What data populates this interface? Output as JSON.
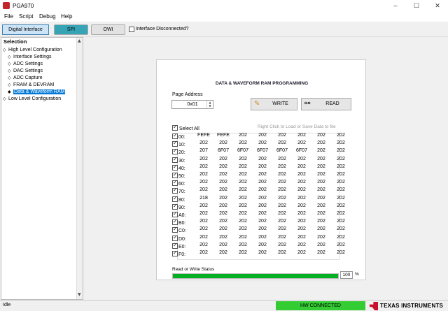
{
  "window": {
    "title": "PGA970",
    "controls": [
      "–",
      "☐",
      "✕"
    ]
  },
  "menu": [
    "File",
    "Script",
    "Debug",
    "Help"
  ],
  "toolbar": {
    "digital_interface": "Digital Interface",
    "spi": "SPI",
    "owi": "OWI",
    "disconnected_label": "Interface Disconnected?"
  },
  "selection": {
    "header": "Selection",
    "items": [
      {
        "label": "High Level Configuration",
        "level": 0,
        "bullet": "◇"
      },
      {
        "label": "Interface Settings",
        "level": 1,
        "bullet": "◇"
      },
      {
        "label": "ADC Settings",
        "level": 1,
        "bullet": "◇"
      },
      {
        "label": "DAC Settings",
        "level": 1,
        "bullet": "◇"
      },
      {
        "label": "ADC Capture",
        "level": 1,
        "bullet": "◇"
      },
      {
        "label": "FRAM & DEVRAM",
        "level": 1,
        "bullet": "◇"
      },
      {
        "label": "Data & Waveform RAM",
        "level": 1,
        "bullet": "◆",
        "selected": true
      },
      {
        "label": "Low Level Configuration",
        "level": 0,
        "bullet": "◇"
      }
    ]
  },
  "ram": {
    "title": "DATA & WAVEFORM RAM PROGRAMMING",
    "page_address_label": "Page Address",
    "page_address_value": "0x01",
    "write_label": "WRITE",
    "read_label": "READ",
    "hint": "Right Click to Load or Save Data to file",
    "select_all": "Select All",
    "rows": [
      {
        "addr": "00:",
        "cells": [
          "FEFE",
          "FEFE",
          "202",
          "202",
          "202",
          "202",
          "202",
          "202"
        ]
      },
      {
        "addr": "10:",
        "cells": [
          "202",
          "202",
          "202",
          "202",
          "202",
          "202",
          "202",
          "202"
        ]
      },
      {
        "addr": "20:",
        "cells": [
          "207",
          "6F07",
          "6F07",
          "6F07",
          "6F07",
          "6F07",
          "202",
          "202"
        ]
      },
      {
        "addr": "30:",
        "cells": [
          "202",
          "202",
          "202",
          "202",
          "202",
          "202",
          "202",
          "202"
        ]
      },
      {
        "addr": "40:",
        "cells": [
          "202",
          "202",
          "202",
          "202",
          "202",
          "202",
          "202",
          "202"
        ]
      },
      {
        "addr": "50:",
        "cells": [
          "202",
          "202",
          "202",
          "202",
          "202",
          "202",
          "202",
          "202"
        ]
      },
      {
        "addr": "60:",
        "cells": [
          "202",
          "202",
          "202",
          "202",
          "202",
          "202",
          "202",
          "202"
        ]
      },
      {
        "addr": "70:",
        "cells": [
          "202",
          "202",
          "202",
          "202",
          "202",
          "202",
          "202",
          "202"
        ]
      },
      {
        "addr": "80:",
        "cells": [
          "218",
          "202",
          "202",
          "202",
          "202",
          "202",
          "202",
          "202"
        ]
      },
      {
        "addr": "90:",
        "cells": [
          "202",
          "202",
          "202",
          "202",
          "202",
          "202",
          "202",
          "202"
        ]
      },
      {
        "addr": "A0:",
        "cells": [
          "202",
          "202",
          "202",
          "202",
          "202",
          "202",
          "202",
          "202"
        ]
      },
      {
        "addr": "B0:",
        "cells": [
          "202",
          "202",
          "202",
          "202",
          "202",
          "202",
          "202",
          "202"
        ]
      },
      {
        "addr": "C0:",
        "cells": [
          "202",
          "202",
          "202",
          "202",
          "202",
          "202",
          "202",
          "202"
        ]
      },
      {
        "addr": "D0:",
        "cells": [
          "202",
          "202",
          "202",
          "202",
          "202",
          "202",
          "202",
          "202"
        ]
      },
      {
        "addr": "E0:",
        "cells": [
          "202",
          "202",
          "202",
          "202",
          "202",
          "202",
          "202",
          "202"
        ]
      },
      {
        "addr": "F0:",
        "cells": [
          "202",
          "202",
          "202",
          "202",
          "202",
          "202",
          "202",
          "202"
        ]
      }
    ],
    "status_label": "Read or Write Status",
    "progress": 100,
    "progress_text": "100",
    "progress_unit": "%"
  },
  "statusbar": {
    "state": "Idle",
    "connection": "HW CONNECTED",
    "brand": "TEXAS INSTRUMENTS"
  },
  "colors": {
    "spi_active": "#37a4b5",
    "progress": "#06b025",
    "hw_connected": "#33cc33",
    "ti_red": "#c8102e",
    "selected_item": "#0078d7"
  }
}
